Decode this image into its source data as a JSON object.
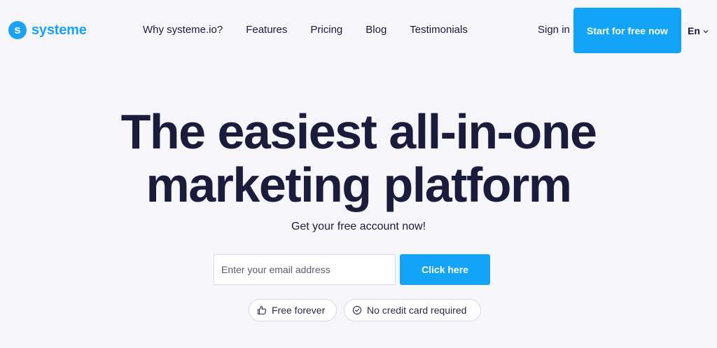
{
  "header": {
    "logo": {
      "mark": "s",
      "text": "systeme"
    },
    "nav": [
      {
        "label": "Why systeme.io?"
      },
      {
        "label": "Features"
      },
      {
        "label": "Pricing"
      },
      {
        "label": "Blog"
      },
      {
        "label": "Testimonials"
      }
    ],
    "sign_in": "Sign in",
    "cta": "Start for free now",
    "language": {
      "selected": "En",
      "icon": "chevron-down-icon"
    }
  },
  "hero": {
    "title_line1": "The easiest all-in-one",
    "title_highlight": "marketing",
    "title_line2_rest": " platform",
    "subtitle": "Get your free account now!",
    "email_placeholder": "Enter your email address",
    "email_value": "",
    "submit_label": "Click here",
    "badges": [
      {
        "label": "Free forever",
        "icon": "thumbs-up-icon"
      },
      {
        "label": "No credit card required",
        "icon": "check-circle-icon"
      }
    ]
  },
  "colors": {
    "accent": "#13a3f7",
    "logo": "#1aa3f6",
    "text": "#1b1c3b",
    "highlight_underline": "#b7f07a",
    "background": "#f5f5fa"
  }
}
